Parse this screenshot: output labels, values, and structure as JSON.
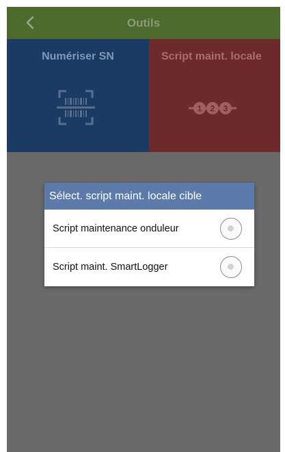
{
  "header": {
    "title": "Outils",
    "back_icon": "chevron-left-icon"
  },
  "tiles": [
    {
      "label": "Numériser SN",
      "icon": "barcode-scan-icon",
      "color": "#1a3b63"
    },
    {
      "label": "Script maint. locale",
      "icon": "numbered-steps-icon",
      "color": "#6e2a2a"
    }
  ],
  "steps_icon_digits": [
    "1",
    "2",
    "3"
  ],
  "dialog": {
    "title": "Sélect. script maint. locale cible",
    "options": [
      {
        "label": "Script maintenance onduleur",
        "selected": false
      },
      {
        "label": "Script maint. SmartLogger",
        "selected": false
      }
    ]
  },
  "colors": {
    "header_bg": "#4d6b2c",
    "dialog_title_bg": "#5c7bab",
    "background_dim": "#6a6a6a"
  }
}
